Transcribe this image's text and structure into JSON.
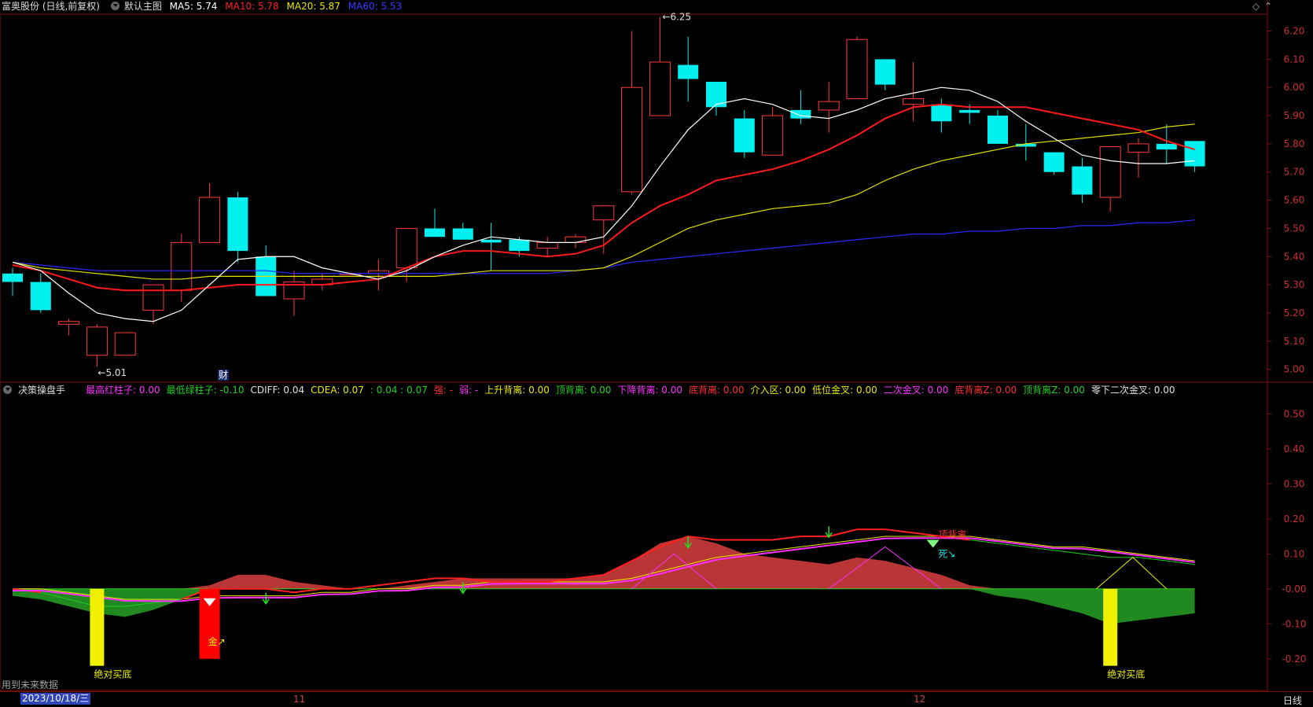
{
  "header": {
    "title": "富奥股份 (日线,前复权)",
    "template": "默认主图",
    "ma": [
      {
        "label": "MA5: 5.74",
        "color": "#ffffff"
      },
      {
        "label": "MA10: 5.78",
        "color": "#ff2020"
      },
      {
        "label": "MA20: 5.87",
        "color": "#e8e800"
      },
      {
        "label": "MA60: 5.53",
        "color": "#3a3aff"
      }
    ]
  },
  "indicator": {
    "name": "决策操盘手",
    "items": [
      {
        "label": "最高红柱子: 0.00",
        "color": "#ff30ff"
      },
      {
        "label": "最低绿柱子: -0.10",
        "color": "#20d020"
      },
      {
        "label": "CDIFF: 0.04",
        "color": "#e0e0e0"
      },
      {
        "label": "CDEA: 0.07",
        "color": "#e8e800"
      },
      {
        "label": ": 0.04 : 0.07",
        "color": "#20d020"
      },
      {
        "label": "强: -",
        "color": "#ff3030"
      },
      {
        "label": "弱: -",
        "color": "#ff30ff"
      },
      {
        "label": "上升背离: 0.00",
        "color": "#e8e800"
      },
      {
        "label": "顶背离: 0.00",
        "color": "#20d020"
      },
      {
        "label": "下降背离: 0.00",
        "color": "#ff30ff"
      },
      {
        "label": "底背离: 0.00",
        "color": "#ff3030"
      },
      {
        "label": "介入区: 0.00",
        "color": "#e8e800"
      },
      {
        "label": "低位金叉: 0.00",
        "color": "#e8e800"
      },
      {
        "label": "二次金叉: 0.00",
        "color": "#ff30ff"
      },
      {
        "label": "底背离Z: 0.00",
        "color": "#ff3030"
      },
      {
        "label": "顶背离Z: 0.00",
        "color": "#20d020"
      },
      {
        "label": "零下二次金叉: 0.00",
        "color": "#e0e0e0"
      }
    ]
  },
  "footer": {
    "future_data_note": "用到未来数据",
    "cursor_date": "2023/10/18/三",
    "x_labels": [
      "11",
      "12"
    ],
    "period": "日线"
  },
  "chart_data": [
    {
      "type": "candlestick",
      "y_ticks": [
        "6.20",
        "6.10",
        "6.00",
        "5.90",
        "5.80",
        "5.70",
        "5.60",
        "5.50",
        "5.40",
        "5.30",
        "5.20",
        "5.10",
        "5.00"
      ],
      "ylim": [
        4.96,
        6.26
      ],
      "annotations": {
        "high": "6.25",
        "low": "5.01",
        "finance_marker": "财"
      },
      "candles": [
        [
          5.34,
          5.36,
          5.26,
          5.31
        ],
        [
          5.31,
          5.34,
          5.2,
          5.21
        ],
        [
          5.16,
          5.18,
          5.12,
          5.17
        ],
        [
          5.05,
          5.16,
          5.01,
          5.15
        ],
        [
          5.05,
          5.13,
          5.05,
          5.13
        ],
        [
          5.21,
          5.3,
          5.16,
          5.3
        ],
        [
          5.28,
          5.48,
          5.24,
          5.45
        ],
        [
          5.45,
          5.66,
          5.45,
          5.61
        ],
        [
          5.61,
          5.63,
          5.38,
          5.42
        ],
        [
          5.4,
          5.44,
          5.26,
          5.26
        ],
        [
          5.25,
          5.35,
          5.19,
          5.31
        ],
        [
          5.3,
          5.34,
          5.28,
          5.32
        ],
        [
          5.34,
          5.34,
          5.34,
          5.34
        ],
        [
          5.34,
          5.39,
          5.28,
          5.35
        ],
        [
          5.36,
          5.5,
          5.31,
          5.5
        ],
        [
          5.5,
          5.57,
          5.47,
          5.47
        ],
        [
          5.5,
          5.52,
          5.47,
          5.46
        ],
        [
          5.46,
          5.52,
          5.35,
          5.45
        ],
        [
          5.46,
          5.47,
          5.4,
          5.42
        ],
        [
          5.43,
          5.47,
          5.4,
          5.45
        ],
        [
          5.45,
          5.48,
          5.43,
          5.47
        ],
        [
          5.53,
          5.58,
          5.41,
          5.58
        ],
        [
          5.63,
          6.2,
          5.62,
          6.0
        ],
        [
          5.9,
          6.25,
          5.9,
          6.09
        ],
        [
          6.08,
          6.18,
          5.95,
          6.03
        ],
        [
          6.02,
          6.02,
          5.9,
          5.93
        ],
        [
          5.89,
          5.92,
          5.75,
          5.77
        ],
        [
          5.76,
          5.93,
          5.76,
          5.9
        ],
        [
          5.92,
          5.99,
          5.87,
          5.89
        ],
        [
          5.92,
          6.02,
          5.84,
          5.95
        ],
        [
          5.96,
          6.18,
          5.97,
          6.17
        ],
        [
          6.1,
          6.1,
          5.99,
          6.01
        ],
        [
          5.94,
          6.09,
          5.88,
          5.96
        ],
        [
          5.94,
          5.96,
          5.84,
          5.88
        ],
        [
          5.92,
          5.94,
          5.87,
          5.91
        ],
        [
          5.9,
          5.92,
          5.8,
          5.8
        ],
        [
          5.8,
          5.87,
          5.74,
          5.79
        ],
        [
          5.77,
          5.77,
          5.69,
          5.7
        ],
        [
          5.72,
          5.75,
          5.59,
          5.62
        ],
        [
          5.61,
          5.79,
          5.56,
          5.79
        ],
        [
          5.77,
          5.82,
          5.68,
          5.8
        ],
        [
          5.8,
          5.87,
          5.73,
          5.78
        ],
        [
          5.81,
          5.81,
          5.7,
          5.72
        ]
      ],
      "ma5": [
        5.38,
        5.35,
        5.27,
        5.2,
        5.18,
        5.17,
        5.21,
        5.3,
        5.39,
        5.4,
        5.4,
        5.36,
        5.34,
        5.32,
        5.35,
        5.4,
        5.44,
        5.47,
        5.46,
        5.45,
        5.45,
        5.47,
        5.58,
        5.72,
        5.85,
        5.94,
        5.96,
        5.94,
        5.9,
        5.89,
        5.92,
        5.96,
        5.98,
        6.0,
        5.99,
        5.95,
        5.88,
        5.82,
        5.76,
        5.74,
        5.73,
        5.73,
        5.74
      ],
      "ma10": [
        5.37,
        5.35,
        5.32,
        5.29,
        5.28,
        5.28,
        5.28,
        5.29,
        5.3,
        5.3,
        5.3,
        5.3,
        5.31,
        5.32,
        5.36,
        5.4,
        5.42,
        5.42,
        5.41,
        5.4,
        5.41,
        5.44,
        5.52,
        5.58,
        5.62,
        5.67,
        5.69,
        5.71,
        5.74,
        5.78,
        5.83,
        5.89,
        5.93,
        5.94,
        5.93,
        5.93,
        5.93,
        5.91,
        5.89,
        5.87,
        5.85,
        5.81,
        5.78
      ],
      "ma20": [
        5.38,
        5.36,
        5.35,
        5.34,
        5.33,
        5.32,
        5.32,
        5.33,
        5.33,
        5.33,
        5.33,
        5.33,
        5.33,
        5.33,
        5.33,
        5.33,
        5.34,
        5.35,
        5.35,
        5.35,
        5.35,
        5.36,
        5.4,
        5.45,
        5.5,
        5.53,
        5.55,
        5.57,
        5.58,
        5.59,
        5.62,
        5.67,
        5.71,
        5.74,
        5.76,
        5.78,
        5.8,
        5.81,
        5.82,
        5.83,
        5.84,
        5.86,
        5.87
      ],
      "ma60": [
        5.38,
        5.37,
        5.36,
        5.35,
        5.35,
        5.35,
        5.35,
        5.35,
        5.35,
        5.35,
        5.34,
        5.34,
        5.34,
        5.34,
        5.34,
        5.34,
        5.34,
        5.34,
        5.34,
        5.34,
        5.35,
        5.36,
        5.38,
        5.39,
        5.4,
        5.41,
        5.42,
        5.43,
        5.44,
        5.45,
        5.46,
        5.47,
        5.48,
        5.48,
        5.49,
        5.49,
        5.5,
        5.5,
        5.51,
        5.51,
        5.52,
        5.52,
        5.53
      ]
    },
    {
      "type": "area",
      "y_ticks": [
        "0.50",
        "0.40",
        "0.30",
        "0.20",
        "0.10",
        "-0.00",
        "-0.10",
        "-0.20"
      ],
      "ylim": [
        -0.25,
        0.55
      ],
      "hist": [
        -0.02,
        -0.03,
        -0.05,
        -0.07,
        -0.08,
        -0.06,
        -0.03,
        0.01,
        0.04,
        0.04,
        0.02,
        0.01,
        0.0,
        0.0,
        0.01,
        0.02,
        0.03,
        0.03,
        0.03,
        0.03,
        0.03,
        0.04,
        0.08,
        0.13,
        0.15,
        0.13,
        0.1,
        0.09,
        0.08,
        0.07,
        0.09,
        0.08,
        0.06,
        0.04,
        0.01,
        -0.02,
        -0.03,
        -0.05,
        -0.07,
        -0.1,
        -0.09,
        -0.08,
        -0.07
      ],
      "cdiff": [
        0.0,
        -0.01,
        -0.03,
        -0.05,
        -0.05,
        -0.04,
        -0.03,
        0.0,
        0.0,
        0.0,
        -0.01,
        0.0,
        0.0,
        0.01,
        0.02,
        0.03,
        0.03,
        0.02,
        0.02,
        0.02,
        0.03,
        0.04,
        0.08,
        0.12,
        0.15,
        0.14,
        0.14,
        0.14,
        0.15,
        0.15,
        0.17,
        0.17,
        0.16,
        0.15,
        0.14,
        0.13,
        0.12,
        0.11,
        0.1,
        0.09,
        0.09,
        0.08,
        0.07
      ],
      "cdea": [
        0.0,
        0.0,
        -0.01,
        -0.02,
        -0.03,
        -0.03,
        -0.03,
        -0.02,
        -0.02,
        -0.02,
        -0.02,
        -0.01,
        -0.01,
        0.0,
        0.0,
        0.01,
        0.01,
        0.02,
        0.02,
        0.02,
        0.02,
        0.02,
        0.03,
        0.05,
        0.07,
        0.09,
        0.1,
        0.11,
        0.12,
        0.13,
        0.14,
        0.15,
        0.15,
        0.15,
        0.15,
        0.14,
        0.13,
        0.12,
        0.12,
        0.11,
        0.1,
        0.09,
        0.08
      ],
      "signals": [
        {
          "text": "绝对买底",
          "color": "#f0f000"
        },
        {
          "text": "金↗",
          "color": "#f0f000"
        },
        {
          "text": "顶背离",
          "color": "#ff3030"
        },
        {
          "text": "死↘",
          "color": "#20e0e0"
        },
        {
          "text": "绝对买底",
          "color": "#f0f000"
        }
      ]
    }
  ]
}
